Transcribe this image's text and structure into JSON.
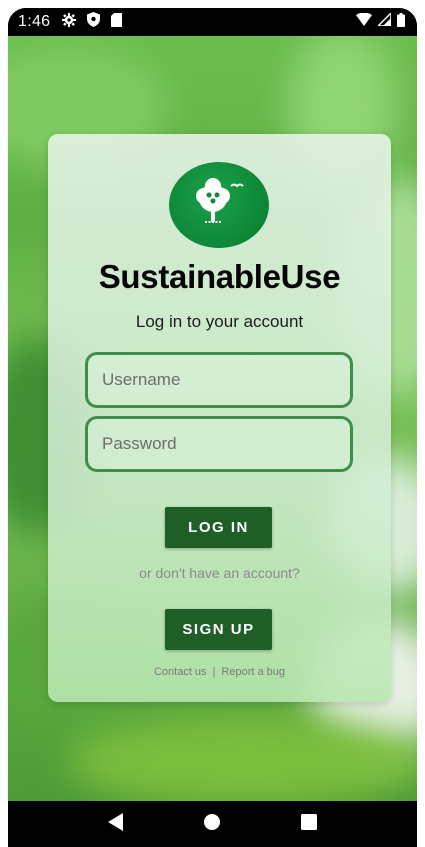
{
  "status_bar": {
    "time": "1:46",
    "left_icons": [
      "gear-icon",
      "shield-icon",
      "sd-card-icon"
    ],
    "right_icons": [
      "wifi-icon",
      "signal-icon",
      "battery-icon"
    ]
  },
  "app": {
    "name": "SustainableUse",
    "subtitle": "Log in to your account",
    "accent_color": "#1f5e27",
    "field_border_color": "#3c8f48"
  },
  "form": {
    "username_placeholder": "Username",
    "password_placeholder": "Password",
    "login_label": "LOG IN",
    "or_text": "or don't have an account?",
    "signup_label": "SIGN UP"
  },
  "footer": {
    "contact_label": "Contact us",
    "separator": "|",
    "bug_label": "Report a bug"
  },
  "nav_bar": {
    "buttons": [
      "back-icon",
      "home-icon",
      "recents-icon"
    ]
  }
}
